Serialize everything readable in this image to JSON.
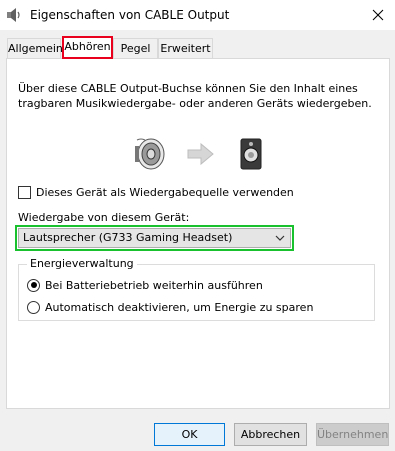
{
  "window": {
    "title": "Eigenschaften von CABLE Output"
  },
  "tabs": [
    {
      "label": "Allgemein",
      "active": false
    },
    {
      "label": "Abhören",
      "active": true
    },
    {
      "label": "Pegel",
      "active": false
    },
    {
      "label": "Erweitert",
      "active": false
    }
  ],
  "listen": {
    "description": "Über diese CABLE Output-Buchse können Sie den Inhalt eines tragbaren Musikwiedergabe- oder anderen Geräts wiedergeben.",
    "listen_checkbox_label": "Dieses Gerät als Wiedergabequelle verwenden",
    "listen_checked": false,
    "playback_label": "Wiedergabe von diesem Gerät:",
    "playback_device": "Lautsprecher (G733 Gaming Headset)"
  },
  "power": {
    "group_title": "Energieverwaltung",
    "options": [
      {
        "label": "Bei Batteriebetrieb weiterhin ausführen",
        "checked": true
      },
      {
        "label": "Automatisch deaktivieren, um Energie zu sparen",
        "checked": false
      }
    ]
  },
  "buttons": {
    "ok": "OK",
    "cancel": "Abbrechen",
    "apply": "Übernehmen"
  },
  "highlights": {
    "tab_color": "#e8001c",
    "dropdown_color": "#19c12e"
  }
}
